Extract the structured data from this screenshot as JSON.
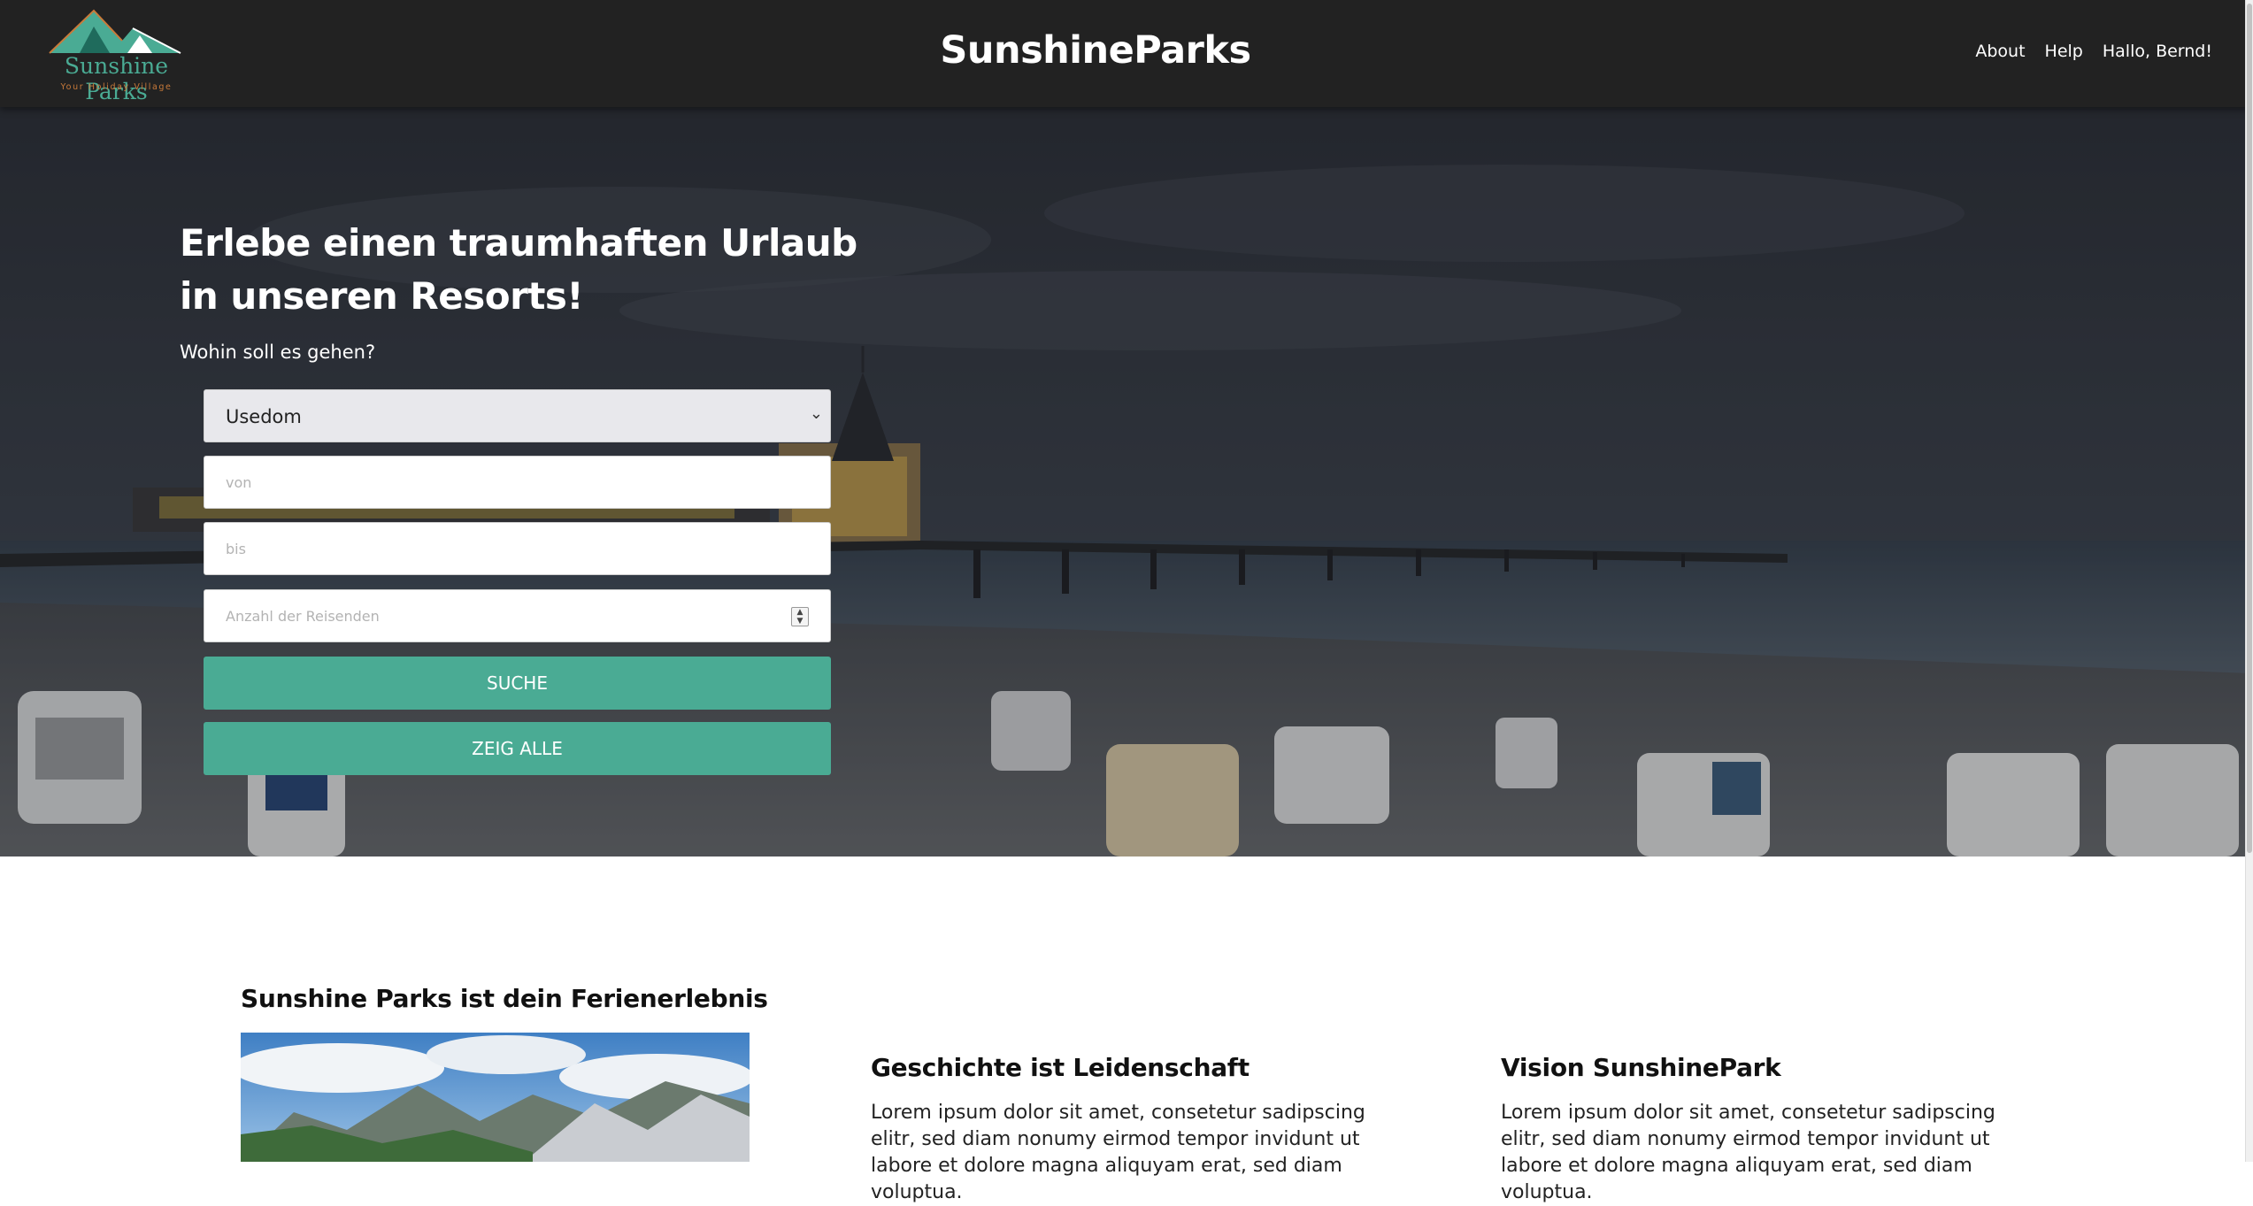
{
  "header": {
    "logo_name": "Sunshine Parks",
    "logo_tagline": "Your Holiday Village",
    "brand": "SunshineParks",
    "nav": [
      "About",
      "Help",
      "Hallo, Bernd!"
    ]
  },
  "hero": {
    "title": "Erlebe einen traumhaften Urlaub in unseren Resorts!",
    "subtitle": "Wohin soll es gehen?",
    "destination_selected": "Usedom",
    "from_placeholder": "von",
    "to_placeholder": "bis",
    "travelers_placeholder": "Anzahl der Reisenden",
    "search_button": "SUCHE",
    "show_all_button": "ZEIG ALLE"
  },
  "content": {
    "section_title": "Sunshine Parks ist dein Ferienerlebnis",
    "col1_title": "Geschichte ist Leidenschaft",
    "col1_text": "Lorem ipsum dolor sit amet, consetetur sadipscing elitr, sed diam nonumy eirmod tempor invidunt ut labore et dolore magna aliquyam erat, sed diam voluptua.",
    "col2_title": "Vision SunshinePark",
    "col2_text": "Lorem ipsum dolor sit amet, consetetur sadipscing elitr, sed diam nonumy eirmod tempor invidunt ut labore et dolore magna aliquyam erat, sed diam voluptua."
  },
  "colors": {
    "header_bg": "#222222",
    "accent": "#4aab94",
    "logo_tagline": "#c97a3a"
  },
  "icons": {
    "logo": "mountain-logo-icon",
    "select_chevron": "chevron-down-icon",
    "spinner": "number-spinner-icon"
  }
}
